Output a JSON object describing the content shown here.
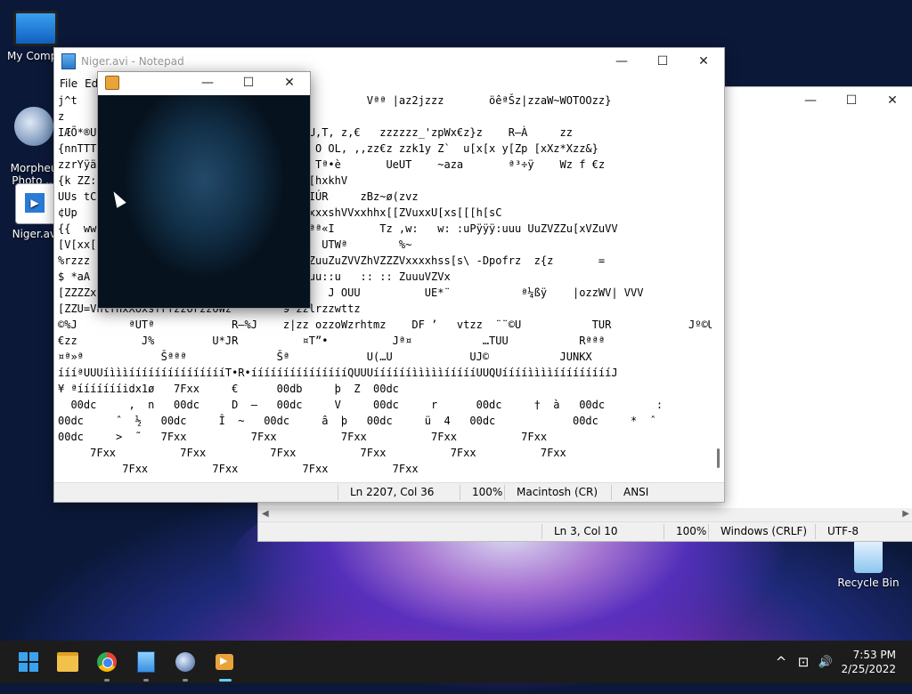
{
  "desktop": {
    "icons": [
      {
        "label": "My Compu",
        "icon": "monitor-icon"
      },
      {
        "label": "Morpheu\nPhoto ...",
        "icon": "morpheus-icon"
      },
      {
        "label": "Niger.avi",
        "icon": "video-file-icon"
      },
      {
        "label": "Recycle Bin",
        "icon": "recycle-bin-icon"
      }
    ]
  },
  "notepad_back": {
    "controls": {
      "minimize": "—",
      "maximize": "☐",
      "close": "✕"
    },
    "status": {
      "position": "Ln 3, Col 10",
      "zoom": "100%",
      "line_ending": "Windows (CRLF)",
      "encoding": "UTF-8"
    }
  },
  "notepad_front": {
    "title": "Niger.avi - Notepad",
    "controls": {
      "minimize": "—",
      "maximize": "☐",
      "close": "✕"
    },
    "menu": [
      "File",
      "Ed"
    ],
    "content": "j^t                                UUU          Vªª |az2jzzz       öêªŠz|zzaW~WOTOOzz}\nz       \nIÆÕ*®U                          gz|ö}WýU,T, z,€   zzzzzz_'zpWx€z}z    R—À     zz\n{nnTTT                         ·÷ïy ~Wz O OL, ,,zz€z zzk1y Z`  u[x[x y[Zp [xXz*Xzz&}\nzzrYÿä                         1knTTò   Tª•è       UeUT    ~aza       ª³÷ÿ    Wz f €z\n{k ZZ:                         xhxxxZ[V[hxkhV\nUUs tC                                UIÚR     zBz~ø(zvz   \n¢Up                          :w:VxU[xxxxxxshVVxxhhx[[ZVuxxU[xs[[[h[sC\n{{  ww                        z}zjz    ªª«I       Tz ,w:   w: :uPÿÿÿ:uuu UuZVZZu[xVZuVV\n[V[xx[                        WS UUá     UTWª        %~\n%rzzz                         wwuu uV uZuuZuZVVZhVZZZVxxxxhss[s\\ -Dpofrz  z{z       =\n$ *aA                        ß÷ïozrzz::uu::u   :: :: ZuuuVZVx\n[ZZZZx                        18zSOvvr    J OUU          UE*¨           ª¼ßÿ    |ozzWV| VVV\n[ZZU=VhlfhxXoxsfrfzzorzzOWz        9¨zzlrzzwttz \n©%J        ªUTª            R—%J    z|zz ozzoWzrhtmz    DF ’   vtzz  ¨¨©U           TUR            Jº©U    y\n€zz          J%         U*JR          ¤T”•          Jª¤           …TUU           Rªªª              \n¤ª»ª            Šªªª              Šª            U(…U            UJ©           JUNKX\níííªUUUíìììíííííííííííííííT•R•íííííííííííííííQUUUííííííìììììíííííUUQUííííììììíííííííííJ\n¥ ªíííííííidx1ø   7Fxx     €      00db     þ  Z  00dc        \n  00dc     ,  n   00dc     D  –   00dc     V     00dc     r      00dc     †  à   00dc        : \n00dc     ˆ  ½   00dc     Î  ~   00dc     â  þ   00dc     ü  4   00dc            00dc     *  ˆ \n00dc     >  ˜   7Fxx          7Fxx          7Fxx          7Fxx          7Fxx\n     7Fxx          7Fxx          7Fxx          7Fxx          7Fxx          7Fxx\n          7Fxx          7Fxx          7Fxx          7Fxx",
    "status": {
      "position": "Ln 2207, Col 36",
      "zoom": "100%",
      "line_ending": "Macintosh (CR)",
      "encoding": "ANSI"
    }
  },
  "player": {
    "controls": {
      "minimize": "—",
      "maximize": "☐",
      "close": "✕"
    }
  },
  "taskbar": {
    "apps": [
      "start-icon",
      "file-explorer-icon",
      "chrome-icon",
      "notepad-icon",
      "morpheus-icon",
      "video-player-icon"
    ],
    "tray": {
      "chevron": "^",
      "network": "⊡",
      "volume": "🔊"
    },
    "time": "7:53 PM",
    "date": "2/25/2022"
  }
}
